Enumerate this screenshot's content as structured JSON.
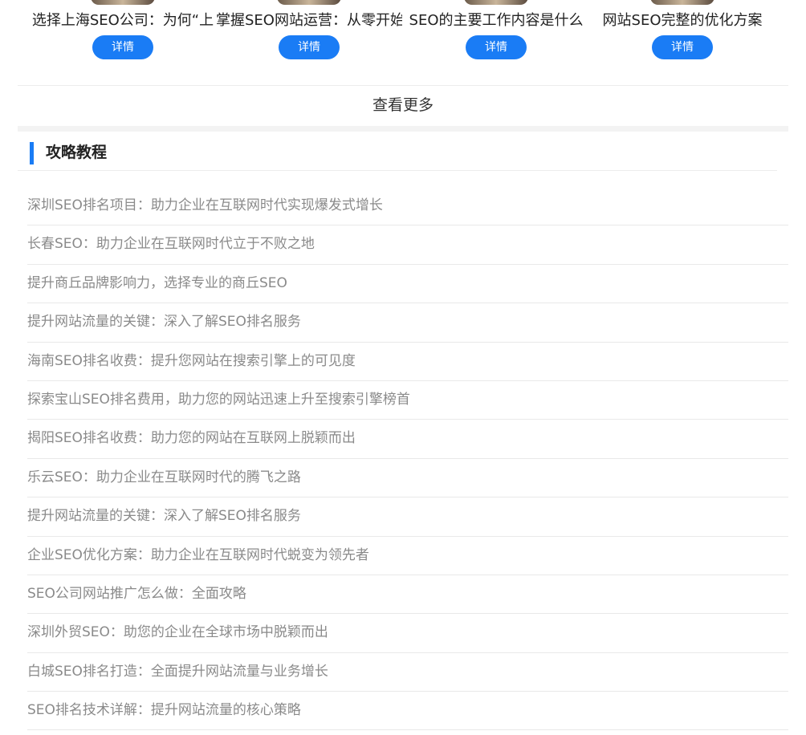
{
  "cards": [
    {
      "title": "选择上海SEO公司：为何“上",
      "button": "详情"
    },
    {
      "title": "掌握SEO网站运营：从零开始",
      "button": "详情"
    },
    {
      "title": "SEO的主要工作内容是什么",
      "button": "详情"
    },
    {
      "title": "网站SEO完整的优化方案",
      "button": "详情"
    }
  ],
  "more": {
    "label": "查看更多"
  },
  "section": {
    "title": "攻略教程",
    "accent_color": "#1a7cf5",
    "items": [
      "深圳SEO排名项目：助力企业在互联网时代实现爆发式增长",
      "长春SEO：助力企业在互联网时代立于不败之地",
      "提升商丘品牌影响力，选择专业的商丘SEO",
      "提升网站流量的关键：深入了解SEO排名服务",
      "海南SEO排名收费：提升您网站在搜索引擎上的可见度",
      "探索宝山SEO排名费用，助力您的网站迅速上升至搜索引擎榜首",
      "揭阳SEO排名收费：助力您的网站在互联网上脱颖而出",
      "乐云SEO：助力企业在互联网时代的腾飞之路",
      "提升网站流量的关键：深入了解SEO排名服务",
      "企业SEO优化方案：助力企业在互联网时代蜕变为领先者",
      "SEO公司网站推广怎么做：全面攻略",
      "深圳外贸SEO：助您的企业在全球市场中脱颖而出",
      "白城SEO排名打造：全面提升网站流量与业务增长",
      "SEO排名技术详解：提升网站流量的核心策略"
    ]
  }
}
